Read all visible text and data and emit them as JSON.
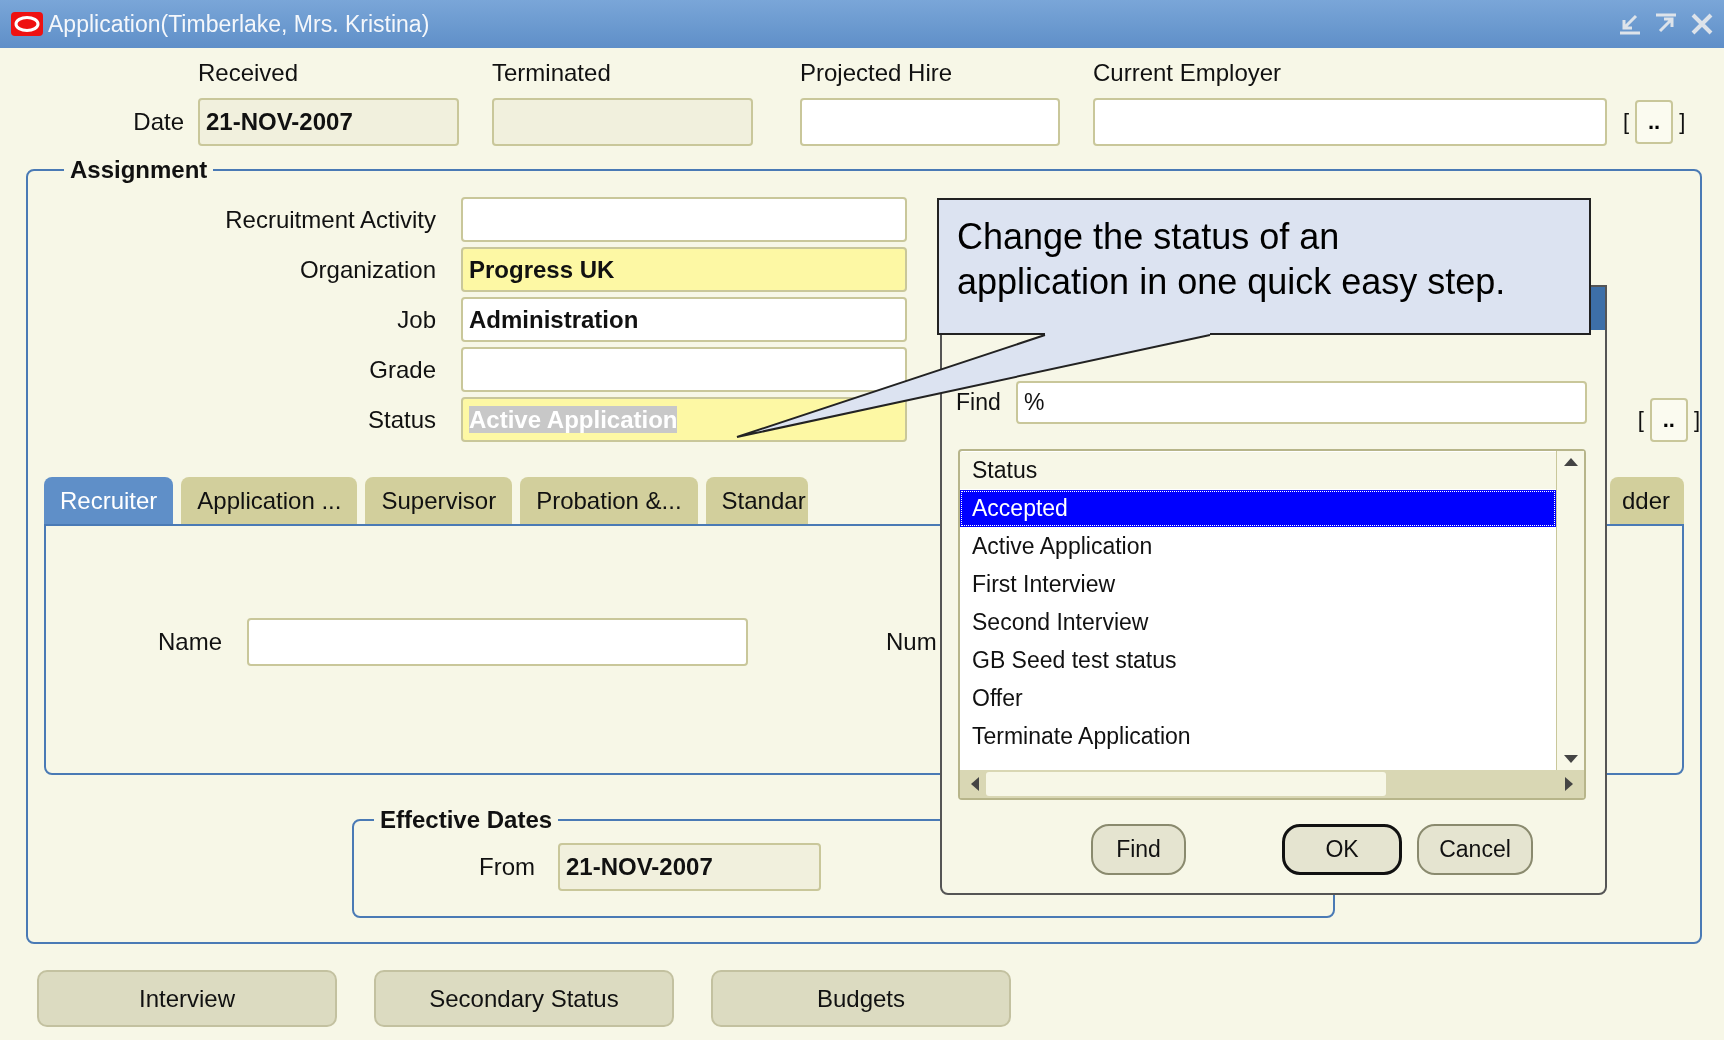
{
  "window": {
    "title": "Application(Timberlake, Mrs. Kristina)"
  },
  "header": {
    "row_label": "Date",
    "fields": [
      {
        "label": "Received",
        "value": "21-NOV-2007",
        "disabled": true
      },
      {
        "label": "Terminated",
        "disabled": true
      },
      {
        "label": "Projected Hire",
        "disabled": false
      },
      {
        "label": "Current Employer",
        "disabled": false
      }
    ],
    "open_bracket": "[",
    "more_button": "..",
    "close_bracket": "]"
  },
  "assignment": {
    "title": "Assignment",
    "fields": [
      {
        "label": "Recruitment Activity",
        "required": false
      },
      {
        "label": "Organization",
        "value": "Progress UK",
        "required": true
      },
      {
        "label": "Job",
        "value": "Administration",
        "required": false
      },
      {
        "label": "Grade",
        "required": false
      },
      {
        "label": "Status",
        "value": "Active Application",
        "required": true,
        "selected": true
      }
    ],
    "open_bracket": "[",
    "more_button": "..",
    "close_bracket": "]"
  },
  "tabs": [
    {
      "label": "Recruiter",
      "selected": true
    },
    {
      "label": "Application ...",
      "selected": false
    },
    {
      "label": "Supervisor",
      "selected": false
    },
    {
      "label": "Probation &...",
      "selected": false
    },
    {
      "label": "Standar",
      "selected": false
    },
    {
      "label": "dder",
      "selected": false
    }
  ],
  "recruiter_panel": {
    "name_label": "Name",
    "number_label": "Num"
  },
  "effective_dates": {
    "title": "Effective Dates",
    "from_label": "From",
    "from_value": "21-NOV-2007"
  },
  "buttons": [
    "Interview",
    "Secondary Status",
    "Budgets"
  ],
  "lov_dialog": {
    "find_label": "Find",
    "find_value": "%",
    "column": "Status",
    "items": [
      {
        "label": "Accepted",
        "selected": true
      },
      {
        "label": "Active Application",
        "selected": false
      },
      {
        "label": "First Interview",
        "selected": false
      },
      {
        "label": "Second Interview",
        "selected": false
      },
      {
        "label": "GB Seed test status",
        "selected": false
      },
      {
        "label": "Offer",
        "selected": false
      },
      {
        "label": "Terminate Application",
        "selected": false
      }
    ],
    "buttons": [
      {
        "label": "Find",
        "default": false
      },
      {
        "label": "OK",
        "default": true
      },
      {
        "label": "Cancel",
        "default": false
      }
    ]
  },
  "callout": {
    "text": "Change the status of an\napplication in one quick easy step."
  }
}
